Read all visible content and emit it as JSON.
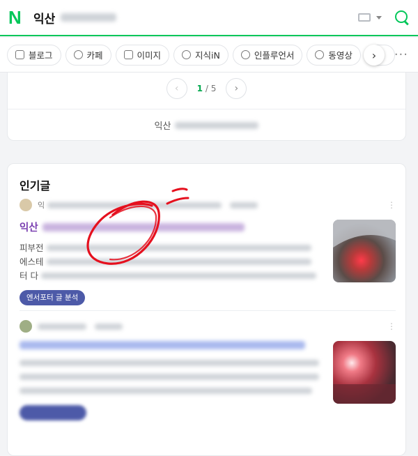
{
  "header": {
    "logo": "N",
    "query": "익산",
    "brand_color": "#03c75a"
  },
  "tabs": [
    {
      "label": "블로그",
      "icon": "blog-icon"
    },
    {
      "label": "카페",
      "icon": "cafe-icon"
    },
    {
      "label": "이미지",
      "icon": "image-icon"
    },
    {
      "label": "지식iN",
      "icon": "kin-icon"
    },
    {
      "label": "인플루언서",
      "icon": "person-icon"
    },
    {
      "label": "동영상",
      "icon": "play-icon"
    }
  ],
  "pagination": {
    "current": "1",
    "total": "/ 5"
  },
  "more_link": {
    "prefix": "익산"
  },
  "popular": {
    "title": "인기글",
    "posts": [
      {
        "author_prefix": "익",
        "title_prefix": "익산",
        "snippet_lines": [
          "피부전",
          "에스테",
          "터 다"
        ],
        "badge": "엔서포터 글 분석",
        "title_color": "#7a3fb0"
      },
      {
        "badge": "",
        "title_color": "#2a55d6"
      }
    ]
  }
}
